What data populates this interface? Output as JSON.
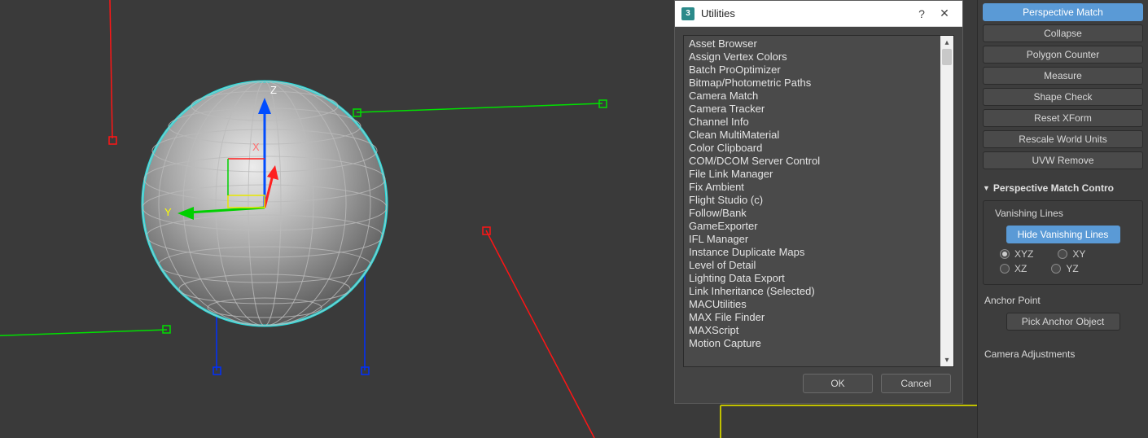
{
  "dialog": {
    "icon_char": "3",
    "title": "Utilities",
    "help": "?",
    "close": "✕",
    "items": [
      "Asset Browser",
      "Assign Vertex Colors",
      "Batch ProOptimizer",
      "Bitmap/Photometric Paths",
      "Camera Match",
      "Camera Tracker",
      "Channel Info",
      "Clean MultiMaterial",
      "Color Clipboard",
      "COM/DCOM Server Control",
      "File Link Manager",
      "Fix Ambient",
      "Flight Studio (c)",
      "Follow/Bank",
      "GameExporter",
      "IFL Manager",
      "Instance Duplicate Maps",
      "Level of Detail",
      "Lighting Data Export",
      "Link Inheritance (Selected)",
      "MACUtilities",
      "MAX File Finder",
      "MAXScript",
      "Motion Capture"
    ],
    "ok": "OK",
    "cancel": "Cancel"
  },
  "panel_buttons": [
    "Perspective Match",
    "Collapse",
    "Polygon Counter",
    "Measure",
    "Shape Check",
    "Reset XForm",
    "Rescale World Units",
    "UVW Remove"
  ],
  "rollout_title": "Perspective Match Contro",
  "vanishing_group": "Vanishing Lines",
  "hide_btn": "Hide Vanishing Lines",
  "radios": {
    "xyz": "XYZ",
    "xy": "XY",
    "xz": "XZ",
    "yz": "YZ"
  },
  "anchor_group": "Anchor Point",
  "pick_anchor": "Pick Anchor Object",
  "camera_adj": "Camera Adjustments",
  "gizmo": {
    "x": "X",
    "y": "Y",
    "z": "Z"
  }
}
